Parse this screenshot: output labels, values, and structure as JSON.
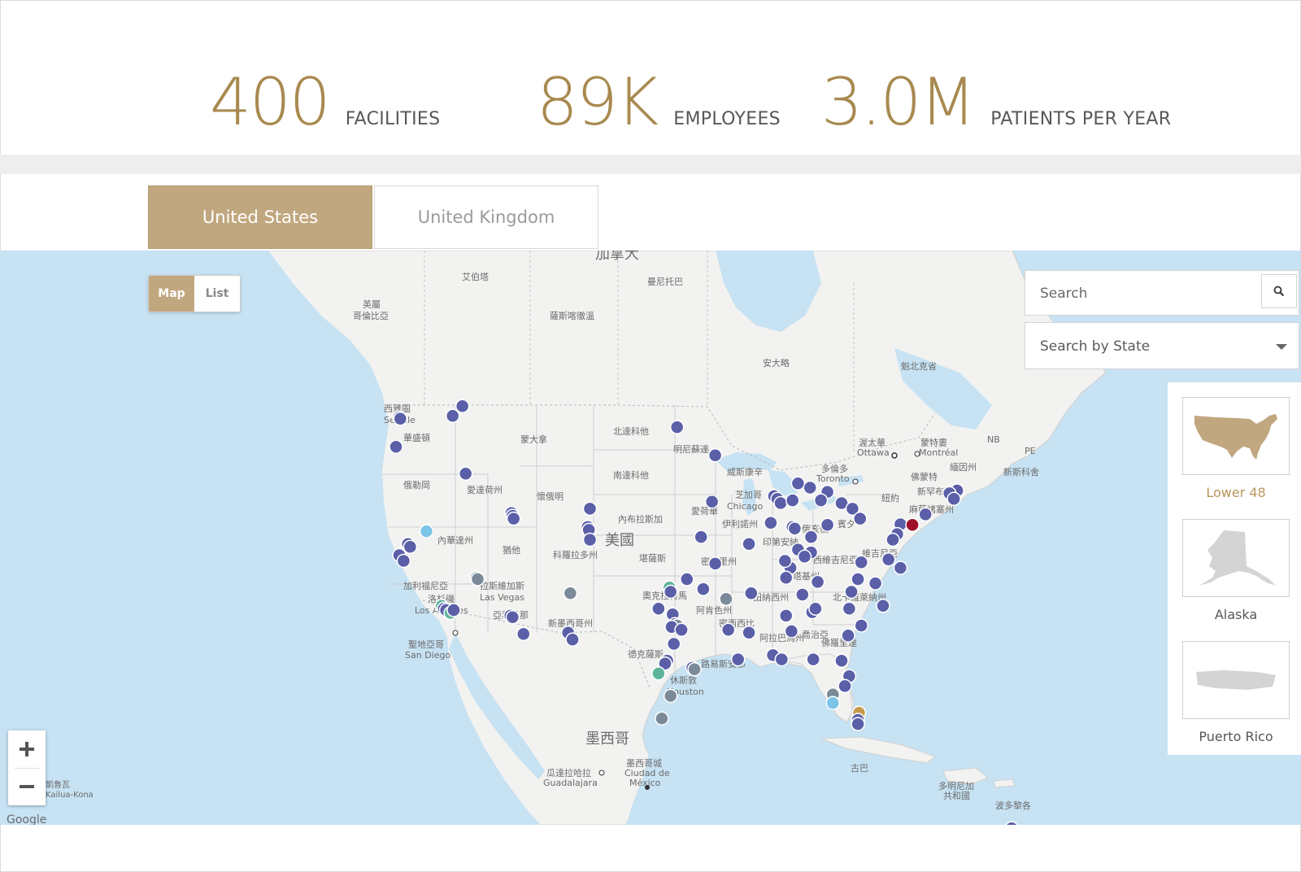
{
  "stats": [
    {
      "value": "400",
      "label": "FACILITIES"
    },
    {
      "value": "89K",
      "label": "EMPLOYEES"
    },
    {
      "value": "3.0M",
      "label": "PATIENTS PER YEAR"
    }
  ],
  "tabs": {
    "active": "United States",
    "inactive": "United Kingdom"
  },
  "view_toggle": {
    "map": "Map",
    "list": "List",
    "selected": "Map"
  },
  "search": {
    "placeholder": "Search",
    "icon": "search-icon"
  },
  "state_select": {
    "value": "Search by State",
    "icon": "chevron-down-icon"
  },
  "regions": [
    {
      "label": "Lower 48",
      "icon": "lower-48-map-icon",
      "selected": true
    },
    {
      "label": "Alaska",
      "icon": "alaska-map-icon",
      "selected": false
    },
    {
      "label": "Puerto Rico",
      "icon": "puerto-rico-map-icon",
      "selected": false
    }
  ],
  "zoom": {
    "in": "+",
    "out": "−"
  },
  "map_labels": [
    "加拿大",
    "艾伯塔",
    "曼尼托巴",
    "英屬",
    "哥倫比亞",
    "薩斯喀徹溫",
    "安大略",
    "魁北克省",
    "西雅圖",
    "Seattle",
    "華盛頓",
    "蒙大拿",
    "北達科他",
    "明尼蘇達",
    "渥太華",
    "Ottawa",
    "蒙特婁",
    "Montréal",
    "NB",
    "PE",
    "俄勒岡",
    "愛達荷州",
    "懷俄明",
    "南達科他",
    "威斯康辛",
    "多倫多",
    "Toronto",
    "佛蒙特",
    "緬因州",
    "新斯科舍",
    "紐約",
    "新罕布夏",
    "麻薩諸塞州",
    "內布拉斯加",
    "美國",
    "內華達州",
    "猶他",
    "科羅拉多州",
    "愛荷華",
    "芝加哥",
    "Chicago",
    "伊利諾州",
    "印第安納",
    "俄亥俄",
    "賓夕",
    "堪薩斯",
    "密蘇里州",
    "肯塔基州",
    "西維吉尼亞",
    "維吉尼亞",
    "北卡羅萊納州",
    "加利福尼亞",
    "拉斯維加斯",
    "Las Vegas",
    "洛杉磯",
    "Los Angeles",
    "亞利桑那",
    "新墨西哥州",
    "奧克拉荷馬",
    "阿肯色州",
    "田納西州",
    "密西西比",
    "阿拉巴馬州",
    "喬治亞",
    "聖地亞哥",
    "San Diego",
    "德克薩斯",
    "路易斯安那",
    "休斯敦",
    "Houston",
    "佛羅里達",
    "墨西哥",
    "古巴",
    "瓜達拉哈拉",
    "Guadalajara",
    "墨西哥城",
    "Ciudad de",
    "México",
    "多明尼加",
    "共和國",
    "波多黎各",
    "凱魯瓦",
    "Kailua-Kona",
    "Google"
  ],
  "marker_colors": {
    "default": "#5a5fa8",
    "teal": "#5fb59b",
    "light_blue": "#7cc5e6",
    "gray": "#7b8a99",
    "highlight": "#a0102a",
    "gold": "#c49a4a"
  },
  "markers": [
    {
      "lat": 47.6,
      "lon": -122.3,
      "kind": "default"
    },
    {
      "lat": 47.5,
      "lon": -122.2,
      "kind": "default"
    },
    {
      "lat": 47.7,
      "lon": -117.4,
      "kind": "default"
    },
    {
      "lat": 48.4,
      "lon": -116.5,
      "kind": "default"
    },
    {
      "lat": 45.5,
      "lon": -122.6,
      "kind": "default"
    },
    {
      "lat": 43.6,
      "lon": -116.2,
      "kind": "default"
    },
    {
      "lat": 40.8,
      "lon": -112.0,
      "kind": "default"
    },
    {
      "lat": 40.6,
      "lon": -111.9,
      "kind": "default"
    },
    {
      "lat": 40.4,
      "lon": -111.8,
      "kind": "default"
    },
    {
      "lat": 41.1,
      "lon": -104.8,
      "kind": "default"
    },
    {
      "lat": 39.8,
      "lon": -105.0,
      "kind": "default"
    },
    {
      "lat": 39.6,
      "lon": -104.9,
      "kind": "default"
    },
    {
      "lat": 38.9,
      "lon": -104.8,
      "kind": "default"
    },
    {
      "lat": 46.9,
      "lon": -96.8,
      "kind": "default"
    },
    {
      "lat": 44.9,
      "lon": -93.3,
      "kind": "default"
    },
    {
      "lat": 39.5,
      "lon": -119.8,
      "kind": "light_blue"
    },
    {
      "lat": 38.6,
      "lon": -121.5,
      "kind": "default"
    },
    {
      "lat": 38.4,
      "lon": -121.3,
      "kind": "default"
    },
    {
      "lat": 37.8,
      "lon": -122.3,
      "kind": "default"
    },
    {
      "lat": 37.4,
      "lon": -121.9,
      "kind": "default"
    },
    {
      "lat": 36.2,
      "lon": -115.2,
      "kind": "teal"
    },
    {
      "lat": 36.1,
      "lon": -115.1,
      "kind": "gray"
    },
    {
      "lat": 34.2,
      "lon": -118.4,
      "kind": "teal"
    },
    {
      "lat": 34.0,
      "lon": -118.2,
      "kind": "default"
    },
    {
      "lat": 33.9,
      "lon": -118.0,
      "kind": "default"
    },
    {
      "lat": 33.7,
      "lon": -117.6,
      "kind": "teal"
    },
    {
      "lat": 33.9,
      "lon": -117.3,
      "kind": "default"
    },
    {
      "lat": 33.5,
      "lon": -112.1,
      "kind": "default"
    },
    {
      "lat": 33.4,
      "lon": -111.9,
      "kind": "default"
    },
    {
      "lat": 32.2,
      "lon": -110.9,
      "kind": "default"
    },
    {
      "lat": 35.1,
      "lon": -106.6,
      "kind": "gray"
    },
    {
      "lat": 32.3,
      "lon": -106.8,
      "kind": "default"
    },
    {
      "lat": 31.8,
      "lon": -106.4,
      "kind": "default"
    },
    {
      "lat": 35.5,
      "lon": -97.5,
      "kind": "teal"
    },
    {
      "lat": 35.2,
      "lon": -97.4,
      "kind": "default"
    },
    {
      "lat": 36.1,
      "lon": -95.9,
      "kind": "default"
    },
    {
      "lat": 34.0,
      "lon": -98.5,
      "kind": "default"
    },
    {
      "lat": 33.6,
      "lon": -97.2,
      "kind": "default"
    },
    {
      "lat": 32.9,
      "lon": -97.0,
      "kind": "default"
    },
    {
      "lat": 32.8,
      "lon": -96.8,
      "kind": "gray"
    },
    {
      "lat": 32.7,
      "lon": -97.3,
      "kind": "default"
    },
    {
      "lat": 32.5,
      "lon": -96.4,
      "kind": "default"
    },
    {
      "lat": 31.5,
      "lon": -97.1,
      "kind": "default"
    },
    {
      "lat": 30.3,
      "lon": -97.7,
      "kind": "default"
    },
    {
      "lat": 30.1,
      "lon": -97.9,
      "kind": "default"
    },
    {
      "lat": 29.8,
      "lon": -95.4,
      "kind": "default"
    },
    {
      "lat": 29.7,
      "lon": -95.2,
      "kind": "gray"
    },
    {
      "lat": 29.4,
      "lon": -98.5,
      "kind": "teal"
    },
    {
      "lat": 27.8,
      "lon": -97.4,
      "kind": "gray"
    },
    {
      "lat": 26.2,
      "lon": -98.2,
      "kind": "gray"
    },
    {
      "lat": 30.4,
      "lon": -91.2,
      "kind": "default"
    },
    {
      "lat": 32.5,
      "lon": -92.1,
      "kind": "default"
    },
    {
      "lat": 34.7,
      "lon": -92.3,
      "kind": "gray"
    },
    {
      "lat": 35.4,
      "lon": -94.4,
      "kind": "default"
    },
    {
      "lat": 39.1,
      "lon": -94.6,
      "kind": "default"
    },
    {
      "lat": 37.2,
      "lon": -93.3,
      "kind": "default"
    },
    {
      "lat": 41.6,
      "lon": -93.6,
      "kind": "default"
    },
    {
      "lat": 42.0,
      "lon": -87.9,
      "kind": "default"
    },
    {
      "lat": 41.8,
      "lon": -87.6,
      "kind": "default"
    },
    {
      "lat": 41.5,
      "lon": -87.3,
      "kind": "default"
    },
    {
      "lat": 41.7,
      "lon": -86.2,
      "kind": "default"
    },
    {
      "lat": 40.1,
      "lon": -88.2,
      "kind": "default"
    },
    {
      "lat": 39.8,
      "lon": -86.2,
      "kind": "default"
    },
    {
      "lat": 39.7,
      "lon": -86.0,
      "kind": "default"
    },
    {
      "lat": 38.6,
      "lon": -90.2,
      "kind": "default"
    },
    {
      "lat": 38.2,
      "lon": -85.7,
      "kind": "default"
    },
    {
      "lat": 38.0,
      "lon": -84.5,
      "kind": "default"
    },
    {
      "lat": 37.7,
      "lon": -85.1,
      "kind": "default"
    },
    {
      "lat": 36.9,
      "lon": -86.4,
      "kind": "default"
    },
    {
      "lat": 37.4,
      "lon": -86.9,
      "kind": "default"
    },
    {
      "lat": 42.3,
      "lon": -83.0,
      "kind": "default"
    },
    {
      "lat": 42.6,
      "lon": -84.6,
      "kind": "default"
    },
    {
      "lat": 42.9,
      "lon": -85.7,
      "kind": "default"
    },
    {
      "lat": 41.7,
      "lon": -83.6,
      "kind": "default"
    },
    {
      "lat": 41.5,
      "lon": -81.7,
      "kind": "default"
    },
    {
      "lat": 41.1,
      "lon": -80.7,
      "kind": "default"
    },
    {
      "lat": 39.96,
      "lon": -83.0,
      "kind": "default"
    },
    {
      "lat": 39.1,
      "lon": -84.5,
      "kind": "default"
    },
    {
      "lat": 40.4,
      "lon": -80.0,
      "kind": "default"
    },
    {
      "lat": 40.0,
      "lon": -76.3,
      "kind": "default"
    },
    {
      "lat": 39.95,
      "lon": -75.2,
      "kind": "highlight"
    },
    {
      "lat": 40.7,
      "lon": -74.0,
      "kind": "default"
    },
    {
      "lat": 42.4,
      "lon": -71.1,
      "kind": "default"
    },
    {
      "lat": 42.2,
      "lon": -71.8,
      "kind": "default"
    },
    {
      "lat": 41.8,
      "lon": -71.4,
      "kind": "default"
    },
    {
      "lat": 39.3,
      "lon": -76.6,
      "kind": "default"
    },
    {
      "lat": 38.9,
      "lon": -77.0,
      "kind": "default"
    },
    {
      "lat": 37.5,
      "lon": -77.4,
      "kind": "default"
    },
    {
      "lat": 36.9,
      "lon": -76.3,
      "kind": "default"
    },
    {
      "lat": 37.3,
      "lon": -79.9,
      "kind": "default"
    },
    {
      "lat": 36.1,
      "lon": -80.2,
      "kind": "default"
    },
    {
      "lat": 35.2,
      "lon": -80.8,
      "kind": "default"
    },
    {
      "lat": 35.8,
      "lon": -78.6,
      "kind": "default"
    },
    {
      "lat": 34.2,
      "lon": -77.9,
      "kind": "default"
    },
    {
      "lat": 34.0,
      "lon": -81.0,
      "kind": "default"
    },
    {
      "lat": 32.8,
      "lon": -79.9,
      "kind": "default"
    },
    {
      "lat": 36.2,
      "lon": -86.8,
      "kind": "default"
    },
    {
      "lat": 35.9,
      "lon": -83.9,
      "kind": "default"
    },
    {
      "lat": 35.0,
      "lon": -85.3,
      "kind": "default"
    },
    {
      "lat": 35.1,
      "lon": -90.0,
      "kind": "default"
    },
    {
      "lat": 33.5,
      "lon": -86.8,
      "kind": "default"
    },
    {
      "lat": 32.4,
      "lon": -86.3,
      "kind": "default"
    },
    {
      "lat": 32.3,
      "lon": -90.2,
      "kind": "default"
    },
    {
      "lat": 33.75,
      "lon": -84.4,
      "kind": "default"
    },
    {
      "lat": 34.0,
      "lon": -84.1,
      "kind": "default"
    },
    {
      "lat": 32.1,
      "lon": -81.1,
      "kind": "default"
    },
    {
      "lat": 30.4,
      "lon": -84.3,
      "kind": "default"
    },
    {
      "lat": 30.3,
      "lon": -81.7,
      "kind": "default"
    },
    {
      "lat": 29.2,
      "lon": -81.0,
      "kind": "default"
    },
    {
      "lat": 28.5,
      "lon": -81.4,
      "kind": "default"
    },
    {
      "lat": 27.9,
      "lon": -82.5,
      "kind": "gray"
    },
    {
      "lat": 27.3,
      "lon": -82.5,
      "kind": "light_blue"
    },
    {
      "lat": 26.6,
      "lon": -80.1,
      "kind": "gold"
    },
    {
      "lat": 26.1,
      "lon": -80.2,
      "kind": "default"
    },
    {
      "lat": 25.8,
      "lon": -80.2,
      "kind": "default"
    },
    {
      "lat": 30.7,
      "lon": -88.0,
      "kind": "default"
    },
    {
      "lat": 30.4,
      "lon": -87.2,
      "kind": "default"
    },
    {
      "lat": 18.4,
      "lon": -66.1,
      "kind": "default"
    }
  ]
}
